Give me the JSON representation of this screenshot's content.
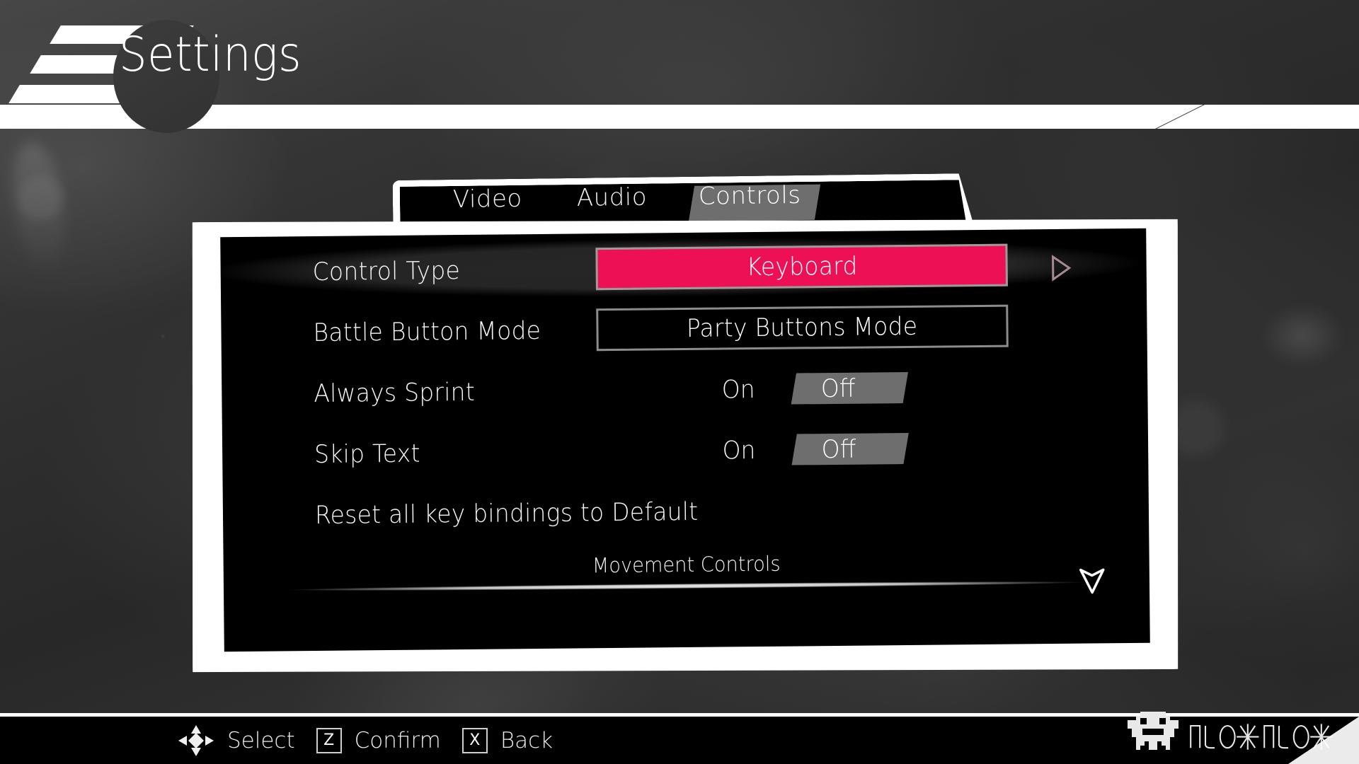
{
  "header": {
    "title": "Settings",
    "logo_icon": "three-slanted-bars-logo"
  },
  "tabs": [
    {
      "label": "Video",
      "selected": false
    },
    {
      "label": "Audio",
      "selected": false
    },
    {
      "label": "Controls",
      "selected": true
    }
  ],
  "settings_rows": [
    {
      "label": "Control Type",
      "type": "value-cycler",
      "value": "Keyboard",
      "selected": true,
      "highlight_color": "#ee1055",
      "has_right_arrow": true
    },
    {
      "label": "Battle Button Mode",
      "type": "value-cycler",
      "value": "Party Buttons Mode",
      "selected": false,
      "has_right_arrow": false
    },
    {
      "label": "Always Sprint",
      "type": "toggle",
      "on_label": "On",
      "off_label": "Off",
      "value": "Off"
    },
    {
      "label": "Skip Text",
      "type": "toggle",
      "on_label": "On",
      "off_label": "Off",
      "value": "Off"
    },
    {
      "label": "Reset all key bindings to Default",
      "type": "action",
      "value": ""
    }
  ],
  "section": {
    "title": "Movement Controls",
    "scroll_indicator": "chevron-down-icon"
  },
  "footer": {
    "hints": [
      {
        "icon": "dpad-icon",
        "label": "Select"
      },
      {
        "key": "Z",
        "label": "Confirm"
      },
      {
        "key": "X",
        "label": "Back"
      }
    ]
  },
  "brand": {
    "mascot_icon": "pixel-robot-mascot-icon",
    "wordmark": "stylized-runic-wordmark"
  },
  "colors": {
    "accent_pink": "#ee1055",
    "highlight_gray": "#6e6e6e",
    "frame_white": "#ffffff",
    "panel_black": "#000000"
  }
}
